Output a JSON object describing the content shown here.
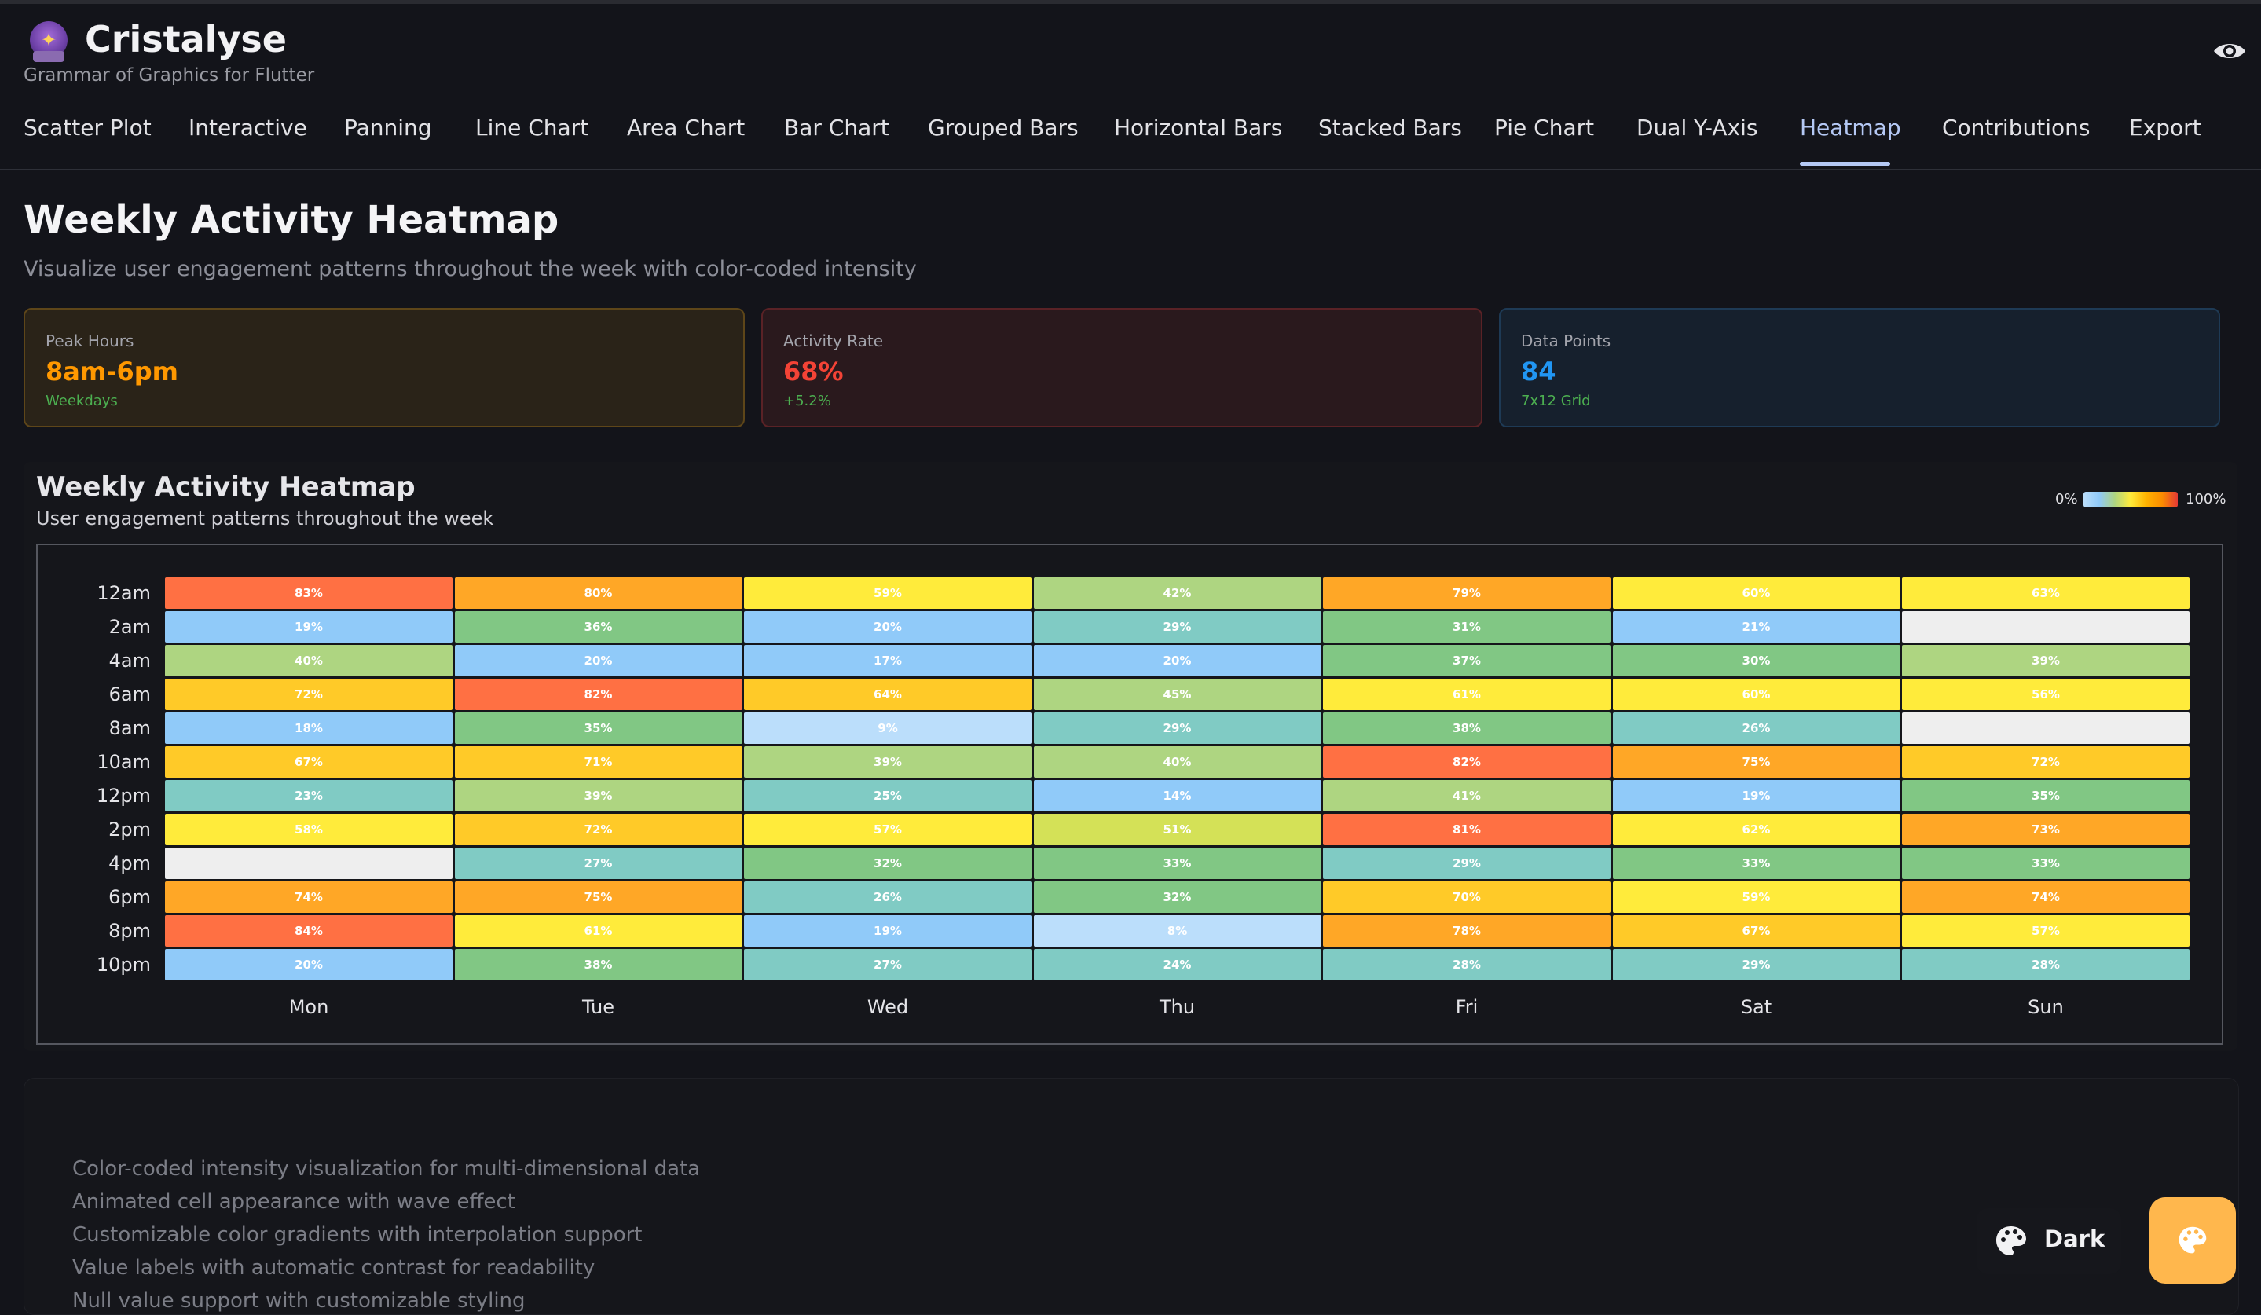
{
  "app": {
    "title": "Cristalyse",
    "subtitle": "Grammar of Graphics for Flutter"
  },
  "tabs": [
    {
      "label": "Scatter Plot"
    },
    {
      "label": "Interactive"
    },
    {
      "label": "Panning"
    },
    {
      "label": "Line Chart"
    },
    {
      "label": "Area Chart"
    },
    {
      "label": "Bar Chart"
    },
    {
      "label": "Grouped Bars"
    },
    {
      "label": "Horizontal Bars"
    },
    {
      "label": "Stacked Bars"
    },
    {
      "label": "Pie Chart"
    },
    {
      "label": "Dual Y-Axis"
    },
    {
      "label": "Heatmap",
      "active": true
    },
    {
      "label": "Contributions"
    },
    {
      "label": "Export"
    }
  ],
  "page": {
    "title": "Weekly Activity Heatmap",
    "description": "Visualize user engagement patterns throughout the week with color-coded intensity"
  },
  "stats": [
    {
      "label": "Peak Hours",
      "value": "8am-6pm",
      "sub": "Weekdays",
      "accent": "#ff9800"
    },
    {
      "label": "Activity Rate",
      "value": "68%",
      "sub": "+5.2%",
      "accent": "#f44336"
    },
    {
      "label": "Data Points",
      "value": "84",
      "sub": "7x12 Grid",
      "accent": "#2196f3"
    }
  ],
  "chart": {
    "title": "Weekly Activity Heatmap",
    "subtitle": "User engagement patterns throughout the week",
    "legend_min": "0%",
    "legend_max": "100%"
  },
  "chart_data": {
    "type": "heatmap",
    "x": [
      "Mon",
      "Tue",
      "Wed",
      "Thu",
      "Fri",
      "Sat",
      "Sun"
    ],
    "y": [
      "12am",
      "2am",
      "4am",
      "6am",
      "8am",
      "10am",
      "12pm",
      "2pm",
      "4pm",
      "6pm",
      "8pm",
      "10pm"
    ],
    "values": [
      [
        83,
        80,
        59,
        42,
        79,
        60,
        63
      ],
      [
        19,
        36,
        20,
        29,
        31,
        21,
        null
      ],
      [
        40,
        20,
        17,
        20,
        37,
        30,
        39
      ],
      [
        72,
        82,
        64,
        45,
        61,
        60,
        56
      ],
      [
        18,
        35,
        9,
        29,
        38,
        26,
        null
      ],
      [
        67,
        71,
        39,
        40,
        82,
        75,
        72
      ],
      [
        23,
        39,
        25,
        14,
        41,
        19,
        35
      ],
      [
        58,
        72,
        57,
        51,
        81,
        62,
        73
      ],
      [
        null,
        27,
        32,
        33,
        29,
        33,
        33
      ],
      [
        74,
        75,
        26,
        32,
        70,
        59,
        74
      ],
      [
        84,
        61,
        19,
        8,
        78,
        67,
        57
      ],
      [
        20,
        38,
        27,
        24,
        28,
        29,
        28
      ]
    ],
    "value_range": [
      0,
      100
    ],
    "legend": "top-right",
    "colors": {
      "null": "#eeeeee",
      "gradient": [
        "#bbdefb",
        "#90caf9",
        "#80cbc4",
        "#81c784",
        "#aed581",
        "#d4e157",
        "#ffeb3b",
        "#ffca28",
        "#ffa726",
        "#ff7043",
        "#ef5350"
      ]
    }
  },
  "features": [
    "Color-coded intensity visualization for multi-dimensional data",
    "Animated cell appearance with wave effect",
    "Customizable color gradients with interpolation support",
    "Value labels with automatic contrast for readability",
    "Null value support with customizable styling"
  ],
  "theme_button": {
    "label": "Dark"
  },
  "icons": {
    "eye": "eye-icon",
    "palette": "palette-icon",
    "logo": "crystal-ball-icon"
  }
}
